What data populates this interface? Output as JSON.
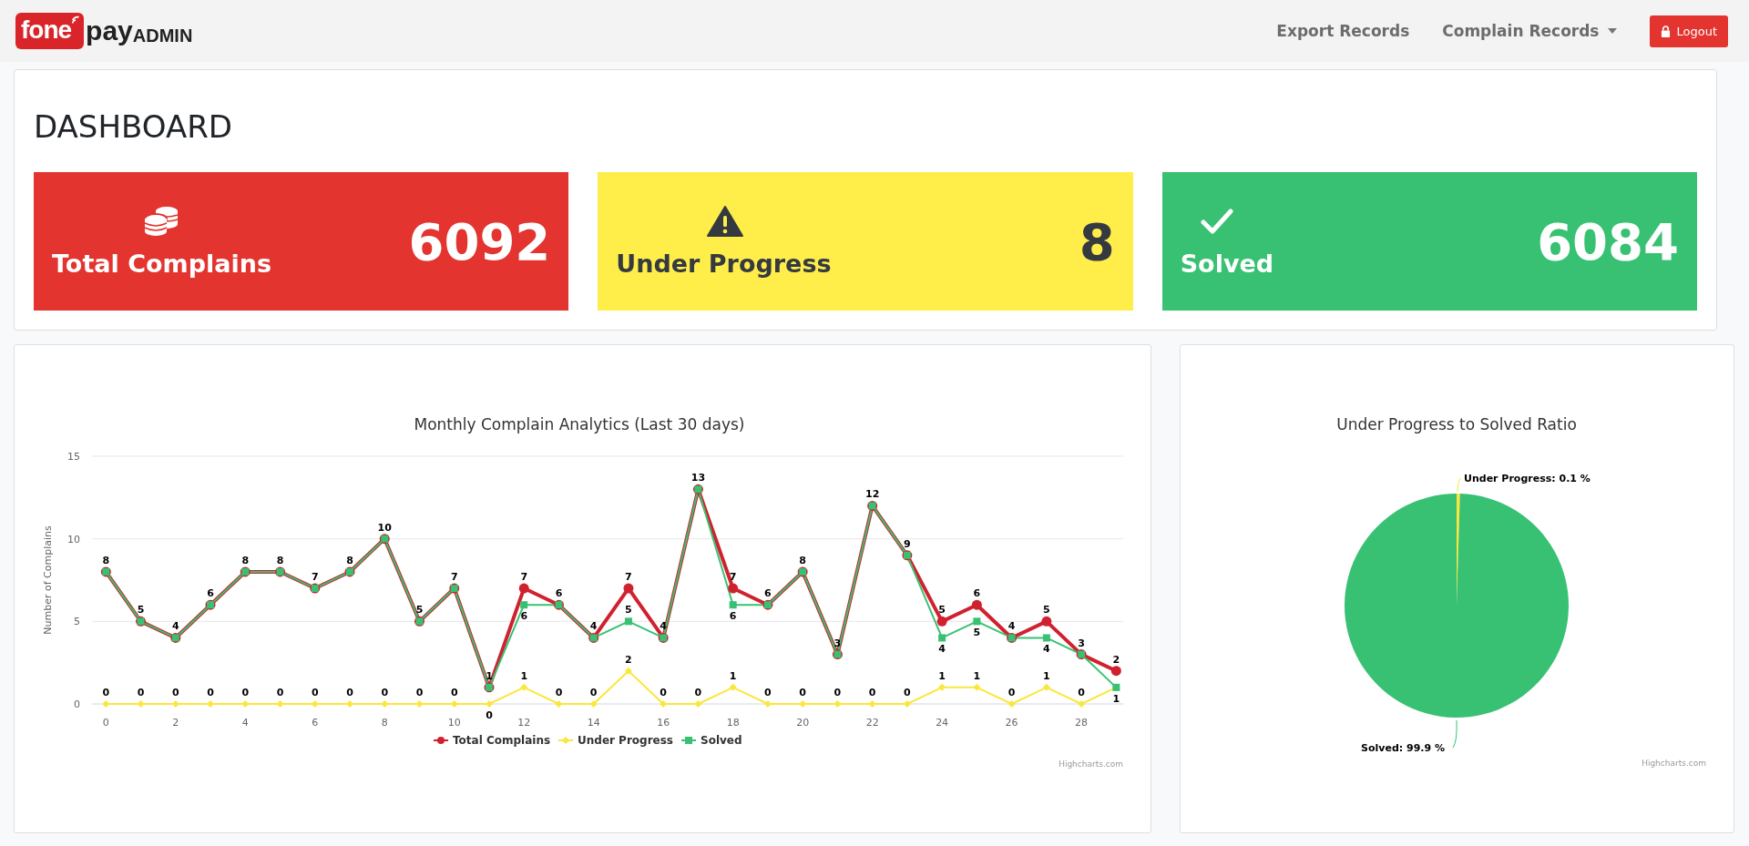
{
  "brand": {
    "logo_text": "fone",
    "name": "pay",
    "suffix": "ADMIN"
  },
  "nav": {
    "links": [
      {
        "label": "Export Records",
        "dropdown": false
      },
      {
        "label": "Complain Records",
        "dropdown": true
      }
    ],
    "logout": "Logout"
  },
  "page_title": "DASHBOARD",
  "stats": [
    {
      "kind": "total",
      "label": "Total Complains",
      "value": "6092",
      "color": "#e3342f"
    },
    {
      "kind": "progress",
      "label": "Under Progress",
      "value": "8",
      "color": "#ffed4a"
    },
    {
      "kind": "solved",
      "label": "Solved",
      "value": "6084",
      "color": "#38c172"
    }
  ],
  "line_chart": {
    "credits": "Highcharts.com",
    "chart_data": {
      "type": "line",
      "title": "Monthly Complain Analytics (Last 30 days)",
      "ylabel": "Number of Complains",
      "x": [
        0,
        1,
        2,
        3,
        4,
        5,
        6,
        7,
        8,
        9,
        10,
        11,
        12,
        13,
        14,
        15,
        16,
        17,
        18,
        19,
        20,
        21,
        22,
        23,
        24,
        25,
        26,
        27,
        28,
        29
      ],
      "xlim": [
        -0.4,
        29.2
      ],
      "ylim": [
        0,
        15
      ],
      "yticks": [
        0,
        5,
        10,
        15
      ],
      "xticks": [
        0,
        2,
        4,
        6,
        8,
        10,
        12,
        14,
        16,
        18,
        20,
        22,
        24,
        26,
        28
      ],
      "legend": true,
      "series": [
        {
          "name": "Total Complains",
          "color": "#d0212f",
          "marker": "circle",
          "values": [
            8,
            5,
            4,
            6,
            8,
            8,
            7,
            8,
            10,
            5,
            7,
            1,
            7,
            6,
            4,
            7,
            4,
            13,
            7,
            6,
            8,
            3,
            12,
            9,
            5,
            6,
            4,
            5,
            3,
            2
          ],
          "value_labels": [
            "8",
            "5",
            "4",
            "6",
            "8",
            "8",
            "7",
            "8",
            "10",
            "5",
            "7",
            "1",
            "7",
            "6",
            "4",
            "7",
            "4",
            "13",
            "7",
            "6",
            "8",
            "3",
            "12",
            "9",
            "5",
            "6",
            "4",
            "5",
            "3",
            "2"
          ]
        },
        {
          "name": "Under Progress",
          "color": "#fbe73c",
          "marker": "diamond",
          "values": [
            0,
            0,
            0,
            0,
            0,
            0,
            0,
            0,
            0,
            0,
            0,
            0,
            1,
            0,
            0,
            2,
            0,
            0,
            1,
            0,
            0,
            0,
            0,
            0,
            1,
            1,
            0,
            1,
            0,
            1
          ],
          "value_labels": [
            "0",
            "0",
            "0",
            "0",
            "0",
            "0",
            "0",
            "0",
            "0",
            "0",
            "0",
            "0",
            "1",
            "0",
            "0",
            "2",
            "0",
            "0",
            "1",
            "0",
            "0",
            "0",
            "0",
            "0",
            "1",
            "1",
            "0",
            "1",
            "0",
            "1"
          ]
        },
        {
          "name": "Solved",
          "color": "#38c172",
          "marker": "square",
          "values": [
            8,
            5,
            4,
            6,
            8,
            8,
            7,
            8,
            10,
            5,
            7,
            1,
            6,
            6,
            4,
            5,
            4,
            13,
            6,
            6,
            8,
            3,
            12,
            9,
            4,
            5,
            4,
            4,
            3,
            1
          ],
          "value_labels": [
            null,
            null,
            null,
            null,
            null,
            null,
            null,
            null,
            null,
            null,
            null,
            null,
            "6",
            null,
            null,
            "5",
            null,
            null,
            "6",
            null,
            null,
            null,
            null,
            null,
            "4",
            "5",
            null,
            "4",
            null,
            null
          ]
        }
      ]
    }
  },
  "pie_chart": {
    "credits": "Highcharts.com",
    "chart_data": {
      "type": "pie",
      "title": "Under Progress to Solved Ratio",
      "values": [
        0.1,
        99.9
      ],
      "value_labels": [
        "Under Progress: 0.1 %",
        "Solved: 99.9 %"
      ],
      "colors": [
        "#fbe73c",
        "#38c172"
      ]
    }
  }
}
